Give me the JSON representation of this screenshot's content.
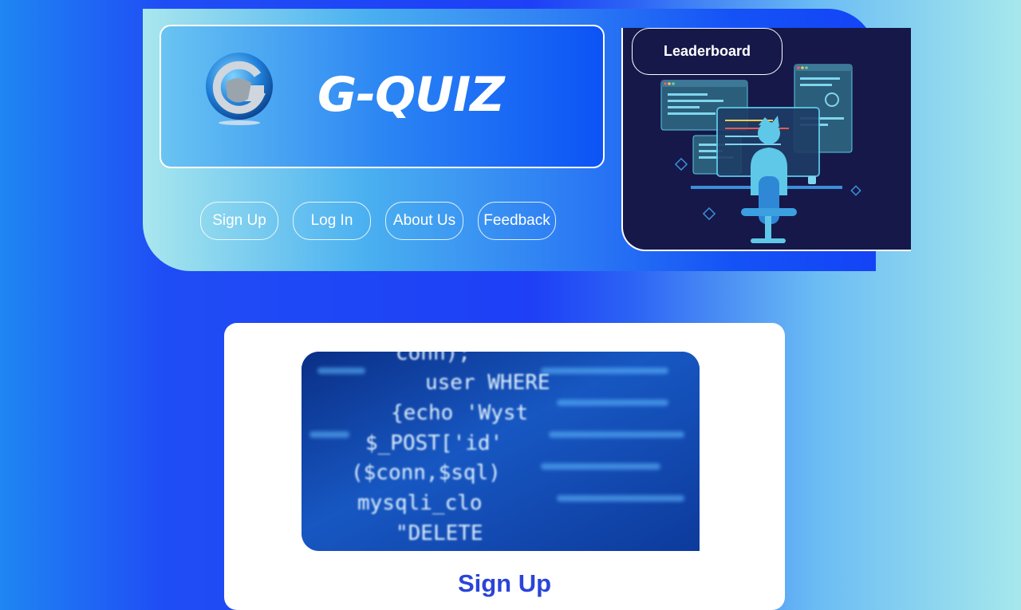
{
  "brand": {
    "title": "G-QUIZ",
    "logo_icon": "g-quiz-logo-icon"
  },
  "nav": {
    "items": [
      {
        "label": "Sign Up"
      },
      {
        "label": "Log In"
      },
      {
        "label": "About Us"
      },
      {
        "label": "Feedback"
      }
    ]
  },
  "leaderboard": {
    "label": "Leaderboard",
    "illustration": "developer-at-computer-illustration"
  },
  "card": {
    "image": "code-closeup-image",
    "image_text": [
      "conn);",
      "user WHERE",
      "{echo 'Wyst",
      "$_POST['id'",
      "($conn,$sql)",
      "mysqli_clo",
      "\"DELETE"
    ],
    "title": "Sign Up"
  },
  "colors": {
    "accent_blue": "#1e3ff6",
    "title_blue": "#2b44d8",
    "dark_navy": "#16184a"
  }
}
